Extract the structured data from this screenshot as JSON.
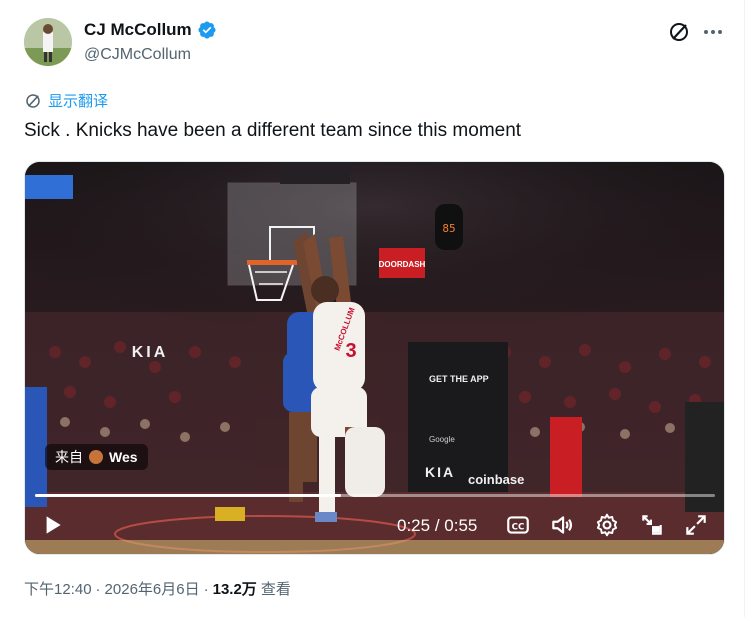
{
  "author": {
    "display_name": "CJ McCollum",
    "handle": "@CJMcCollum",
    "verified": true
  },
  "header_icons": [
    "grok-icon",
    "more-icon"
  ],
  "translate": {
    "label": "显示翻译"
  },
  "tweet": {
    "text": "Sick . Knicks have been a different team since this moment"
  },
  "video": {
    "source_prefix": "来自",
    "source_name": "Wes",
    "current_time": "0:25",
    "separator": "/",
    "duration": "0:55",
    "progress_fraction": 0.45,
    "scoreboard_number": "85",
    "jersey_name": "McCOLLUM",
    "jersey_number": "3",
    "arena_ads": [
      "KIA",
      "DOORDASH",
      "coinbase",
      "GET THE APP",
      "Google"
    ],
    "controls": [
      "play-icon",
      "captions-icon",
      "volume-icon",
      "settings-icon",
      "pip-icon",
      "fullscreen-icon"
    ]
  },
  "meta": {
    "time": "下午12:40",
    "dot1": "·",
    "date": "2026年6月6日",
    "dot2": "·",
    "views_count": "13.2万",
    "views_label": "查看"
  },
  "colors": {
    "link_blue": "#1d9bf0",
    "verified_blue": "#1d9bf0",
    "secondary_text": "#536471",
    "primary_text": "#0f1419"
  }
}
